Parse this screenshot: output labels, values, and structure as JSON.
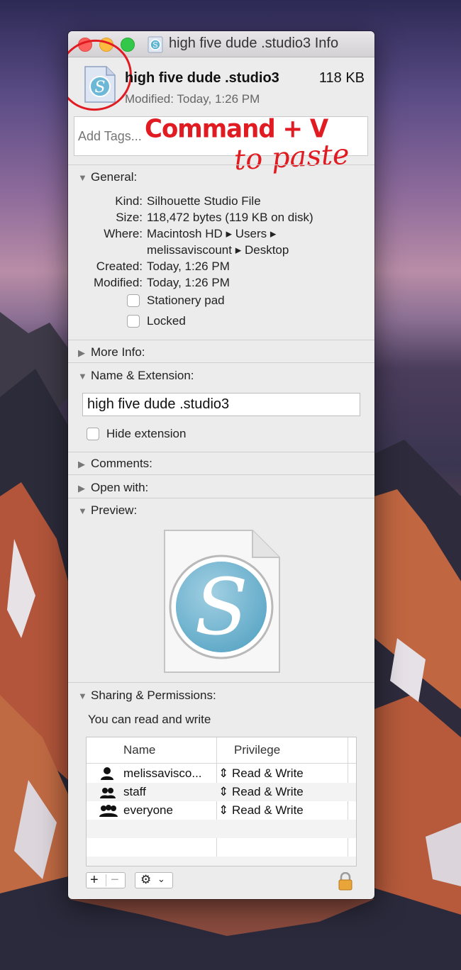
{
  "window": {
    "title": "high five dude .studio3 Info"
  },
  "header": {
    "file_name": "high five dude .studio3",
    "file_size": "118 KB",
    "modified": "Modified: Today, 1:26 PM",
    "tags_placeholder": "Add Tags..."
  },
  "annotations": {
    "command_v": "Command + V",
    "to_paste": "to paste",
    "color": "#e11b22"
  },
  "general": {
    "title": "General:",
    "rows": [
      {
        "label": "Kind:",
        "value": "Silhouette Studio File"
      },
      {
        "label": "Size:",
        "value": "118,472 bytes (119 KB on disk)"
      },
      {
        "label": "Where:",
        "value": "Macintosh HD ▸ Users ▸"
      },
      {
        "label": "",
        "value": "melissaviscount ▸ Desktop"
      },
      {
        "label": "Created:",
        "value": "Today, 1:26 PM"
      },
      {
        "label": "Modified:",
        "value": "Today, 1:26 PM"
      }
    ],
    "stationery_label": "Stationery pad",
    "locked_label": "Locked"
  },
  "more_info": {
    "title": "More Info:"
  },
  "name_ext": {
    "title": "Name & Extension:",
    "name_value": "high five dude .studio3",
    "hide_extension_label": "Hide extension"
  },
  "comments": {
    "title": "Comments:"
  },
  "open_with": {
    "title": "Open with:"
  },
  "preview": {
    "title": "Preview:"
  },
  "sharing": {
    "title": "Sharing & Permissions:",
    "status": "You can read and write",
    "col_name": "Name",
    "col_privilege": "Privilege",
    "rows": [
      {
        "name": "melissavisco...",
        "privilege": "Read & Write",
        "icon": "user-icon"
      },
      {
        "name": "staff",
        "privilege": "Read & Write",
        "icon": "group-icon"
      },
      {
        "name": "everyone",
        "privilege": "Read & Write",
        "icon": "everyone-icon"
      }
    ]
  }
}
